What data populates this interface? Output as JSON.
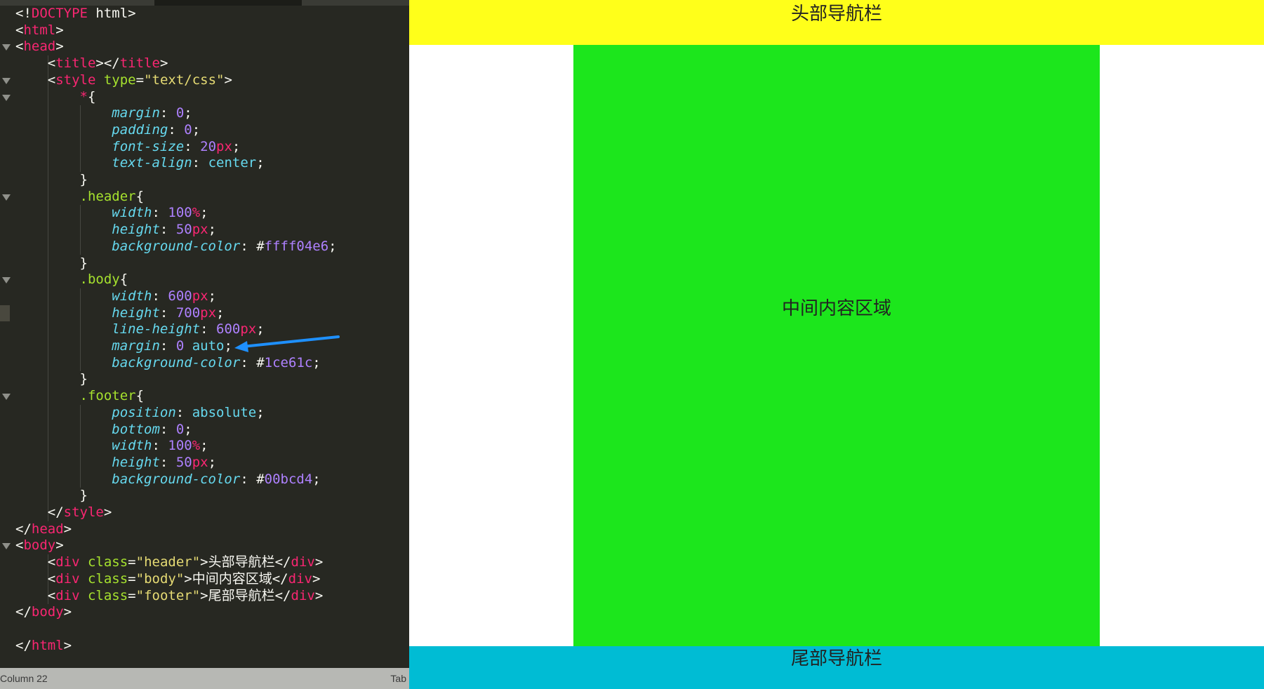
{
  "editor": {
    "lines": [
      [
        [
          "c-punc",
          "<!"
        ],
        [
          "c-tag",
          "DOCTYPE"
        ],
        [
          "c-punc",
          " html>"
        ]
      ],
      [
        [
          "c-punc",
          "<"
        ],
        [
          "c-tag",
          "html"
        ],
        [
          "c-punc",
          ">"
        ]
      ],
      [
        [
          "c-punc",
          "<"
        ],
        [
          "c-tag",
          "head"
        ],
        [
          "c-punc",
          ">"
        ]
      ],
      [
        [
          "c-punc",
          "    <"
        ],
        [
          "c-tag",
          "title"
        ],
        [
          "c-punc",
          "></"
        ],
        [
          "c-tag",
          "title"
        ],
        [
          "c-punc",
          ">"
        ]
      ],
      [
        [
          "c-punc",
          "    <"
        ],
        [
          "c-tag",
          "style"
        ],
        [
          "c-attr",
          " type"
        ],
        [
          "c-punc",
          "="
        ],
        [
          "c-str",
          "\"text/css\""
        ],
        [
          "c-punc",
          ">"
        ]
      ],
      [
        [
          "c-punc",
          "        "
        ],
        [
          "c-tag",
          "*"
        ],
        [
          "c-punc",
          "{"
        ]
      ],
      [
        [
          "c-punc",
          "            "
        ],
        [
          "c-prop",
          "margin"
        ],
        [
          "c-punc",
          ": "
        ],
        [
          "c-num",
          "0"
        ],
        [
          "c-punc",
          ";"
        ]
      ],
      [
        [
          "c-punc",
          "            "
        ],
        [
          "c-prop",
          "padding"
        ],
        [
          "c-punc",
          ": "
        ],
        [
          "c-num",
          "0"
        ],
        [
          "c-punc",
          ";"
        ]
      ],
      [
        [
          "c-punc",
          "            "
        ],
        [
          "c-prop",
          "font-size"
        ],
        [
          "c-punc",
          ": "
        ],
        [
          "c-num",
          "20"
        ],
        [
          "c-unit",
          "px"
        ],
        [
          "c-punc",
          ";"
        ]
      ],
      [
        [
          "c-punc",
          "            "
        ],
        [
          "c-prop",
          "text-align"
        ],
        [
          "c-punc",
          ": "
        ],
        [
          "c-val",
          "center"
        ],
        [
          "c-punc",
          ";"
        ]
      ],
      [
        [
          "c-punc",
          "        }"
        ]
      ],
      [
        [
          "c-punc",
          "        "
        ],
        [
          "c-sel",
          ".header"
        ],
        [
          "c-punc",
          "{"
        ]
      ],
      [
        [
          "c-punc",
          "            "
        ],
        [
          "c-prop",
          "width"
        ],
        [
          "c-punc",
          ": "
        ],
        [
          "c-num",
          "100"
        ],
        [
          "c-unit",
          "%"
        ],
        [
          "c-punc",
          ";"
        ]
      ],
      [
        [
          "c-punc",
          "            "
        ],
        [
          "c-prop",
          "height"
        ],
        [
          "c-punc",
          ": "
        ],
        [
          "c-num",
          "50"
        ],
        [
          "c-unit",
          "px"
        ],
        [
          "c-punc",
          ";"
        ]
      ],
      [
        [
          "c-punc",
          "            "
        ],
        [
          "c-prop",
          "background-color"
        ],
        [
          "c-punc",
          ": #"
        ],
        [
          "c-hash",
          "ffff04e6"
        ],
        [
          "c-punc",
          ";"
        ]
      ],
      [
        [
          "c-punc",
          "        }"
        ]
      ],
      [
        [
          "c-punc",
          "        "
        ],
        [
          "c-sel",
          ".body"
        ],
        [
          "c-punc",
          "{"
        ]
      ],
      [
        [
          "c-punc",
          "            "
        ],
        [
          "c-prop",
          "width"
        ],
        [
          "c-punc",
          ": "
        ],
        [
          "c-num",
          "600"
        ],
        [
          "c-unit",
          "px"
        ],
        [
          "c-punc",
          ";"
        ]
      ],
      [
        [
          "c-punc",
          "            "
        ],
        [
          "c-prop",
          "height"
        ],
        [
          "c-punc",
          ": "
        ],
        [
          "c-num",
          "700"
        ],
        [
          "c-unit",
          "px"
        ],
        [
          "c-punc",
          ";"
        ]
      ],
      [
        [
          "c-punc",
          "            "
        ],
        [
          "c-prop",
          "line-height"
        ],
        [
          "c-punc",
          ": "
        ],
        [
          "c-num",
          "600"
        ],
        [
          "c-unit",
          "px"
        ],
        [
          "c-punc",
          ";"
        ]
      ],
      [
        [
          "c-punc",
          "            "
        ],
        [
          "c-prop",
          "margin"
        ],
        [
          "c-punc",
          ": "
        ],
        [
          "c-num",
          "0"
        ],
        [
          "c-val",
          " auto"
        ],
        [
          "c-punc",
          ";"
        ]
      ],
      [
        [
          "c-punc",
          "            "
        ],
        [
          "c-prop",
          "background-color"
        ],
        [
          "c-punc",
          ": #"
        ],
        [
          "c-hash",
          "1ce61c"
        ],
        [
          "c-punc",
          ";"
        ]
      ],
      [
        [
          "c-punc",
          "        }"
        ]
      ],
      [
        [
          "c-punc",
          "        "
        ],
        [
          "c-sel",
          ".footer"
        ],
        [
          "c-punc",
          "{"
        ]
      ],
      [
        [
          "c-punc",
          "            "
        ],
        [
          "c-prop",
          "position"
        ],
        [
          "c-punc",
          ": "
        ],
        [
          "c-val",
          "absolute"
        ],
        [
          "c-punc",
          ";"
        ]
      ],
      [
        [
          "c-punc",
          "            "
        ],
        [
          "c-prop",
          "bottom"
        ],
        [
          "c-punc",
          ": "
        ],
        [
          "c-num",
          "0"
        ],
        [
          "c-punc",
          ";"
        ]
      ],
      [
        [
          "c-punc",
          "            "
        ],
        [
          "c-prop",
          "width"
        ],
        [
          "c-punc",
          ": "
        ],
        [
          "c-num",
          "100"
        ],
        [
          "c-unit",
          "%"
        ],
        [
          "c-punc",
          ";"
        ]
      ],
      [
        [
          "c-punc",
          "            "
        ],
        [
          "c-prop",
          "height"
        ],
        [
          "c-punc",
          ": "
        ],
        [
          "c-num",
          "50"
        ],
        [
          "c-unit",
          "px"
        ],
        [
          "c-punc",
          ";"
        ]
      ],
      [
        [
          "c-punc",
          "            "
        ],
        [
          "c-prop",
          "background-color"
        ],
        [
          "c-punc",
          ": #"
        ],
        [
          "c-hash",
          "00bcd4"
        ],
        [
          "c-punc",
          ";"
        ]
      ],
      [
        [
          "c-punc",
          "        }"
        ]
      ],
      [
        [
          "c-punc",
          "    </"
        ],
        [
          "c-tag",
          "style"
        ],
        [
          "c-punc",
          ">"
        ]
      ],
      [
        [
          "c-punc",
          "</"
        ],
        [
          "c-tag",
          "head"
        ],
        [
          "c-punc",
          ">"
        ]
      ],
      [
        [
          "c-punc",
          "<"
        ],
        [
          "c-tag",
          "body"
        ],
        [
          "c-punc",
          ">"
        ]
      ],
      [
        [
          "c-punc",
          "    <"
        ],
        [
          "c-tag",
          "div"
        ],
        [
          "c-attr",
          " class"
        ],
        [
          "c-punc",
          "="
        ],
        [
          "c-str",
          "\"header\""
        ],
        [
          "c-punc",
          ">"
        ],
        [
          "c-text",
          "头部导航栏"
        ],
        [
          "c-punc",
          "</"
        ],
        [
          "c-tag",
          "div"
        ],
        [
          "c-punc",
          ">"
        ]
      ],
      [
        [
          "c-punc",
          "    <"
        ],
        [
          "c-tag",
          "div"
        ],
        [
          "c-attr",
          " class"
        ],
        [
          "c-punc",
          "="
        ],
        [
          "c-str",
          "\"body\""
        ],
        [
          "c-punc",
          ">"
        ],
        [
          "c-text",
          "中间内容区域"
        ],
        [
          "c-punc",
          "</"
        ],
        [
          "c-tag",
          "div"
        ],
        [
          "c-punc",
          ">"
        ]
      ],
      [
        [
          "c-punc",
          "    <"
        ],
        [
          "c-tag",
          "div"
        ],
        [
          "c-attr",
          " class"
        ],
        [
          "c-punc",
          "="
        ],
        [
          "c-str",
          "\"footer\""
        ],
        [
          "c-punc",
          ">"
        ],
        [
          "c-text",
          "尾部导航栏"
        ],
        [
          "c-punc",
          "</"
        ],
        [
          "c-tag",
          "div"
        ],
        [
          "c-punc",
          ">"
        ]
      ],
      [
        [
          "c-punc",
          "</"
        ],
        [
          "c-tag",
          "body"
        ],
        [
          "c-punc",
          ">"
        ]
      ],
      [],
      [
        [
          "c-punc",
          "</"
        ],
        [
          "c-tag",
          "html"
        ],
        [
          "c-punc",
          ">"
        ]
      ]
    ],
    "fold_lines": [
      2,
      4,
      5,
      11,
      16,
      23,
      32
    ],
    "highlight_line": 18
  },
  "statusbar": {
    "left": "Column 22",
    "right": "Tab"
  },
  "preview": {
    "header_text": "头部导航栏",
    "body_text": "中间内容区域",
    "footer_text": "尾部导航栏"
  },
  "colors": {
    "editor_bg": "#272822",
    "header": "#ffff1a",
    "body": "#1ce61c",
    "footer": "#00bcd4",
    "arrow": "#1e90ff"
  }
}
